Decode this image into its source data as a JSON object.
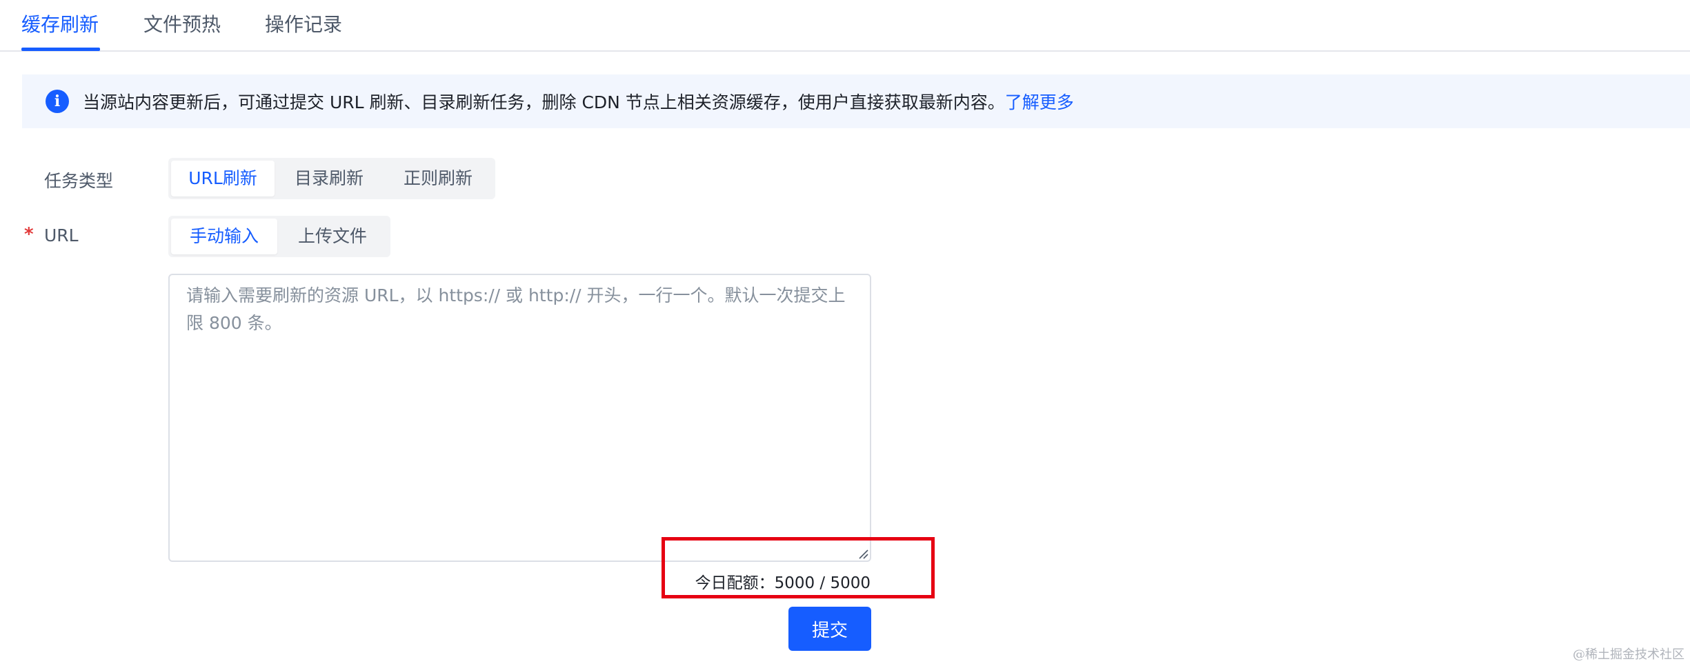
{
  "tabs": [
    {
      "label": "缓存刷新",
      "active": true
    },
    {
      "label": "文件预热",
      "active": false
    },
    {
      "label": "操作记录",
      "active": false
    }
  ],
  "notice": {
    "text": "当源站内容更新后，可通过提交 URL 刷新、目录刷新任务，删除 CDN 节点上相关资源缓存，使用户直接获取最新内容。",
    "link": "了解更多"
  },
  "form": {
    "task_type_label": "任务类型",
    "task_types": [
      {
        "label": "URL刷新",
        "active": true
      },
      {
        "label": "目录刷新",
        "active": false
      },
      {
        "label": "正则刷新",
        "active": false
      }
    ],
    "url_label": "URL",
    "required_mark": "*",
    "input_modes": [
      {
        "label": "手动输入",
        "active": true
      },
      {
        "label": "上传文件",
        "active": false
      }
    ],
    "textarea_value": "",
    "textarea_placeholder": "请输入需要刷新的资源 URL，以 https:// 或 http:// 开头，一行一个。默认一次提交上限 800 条。",
    "quota_text": "今日配额：5000  /  5000",
    "submit_label": "提交"
  },
  "watermark": "@稀土掘金技术社区",
  "colors": {
    "accent": "#165dff",
    "highlight_border": "#e60012",
    "notice_bg": "#f2f6fe"
  }
}
